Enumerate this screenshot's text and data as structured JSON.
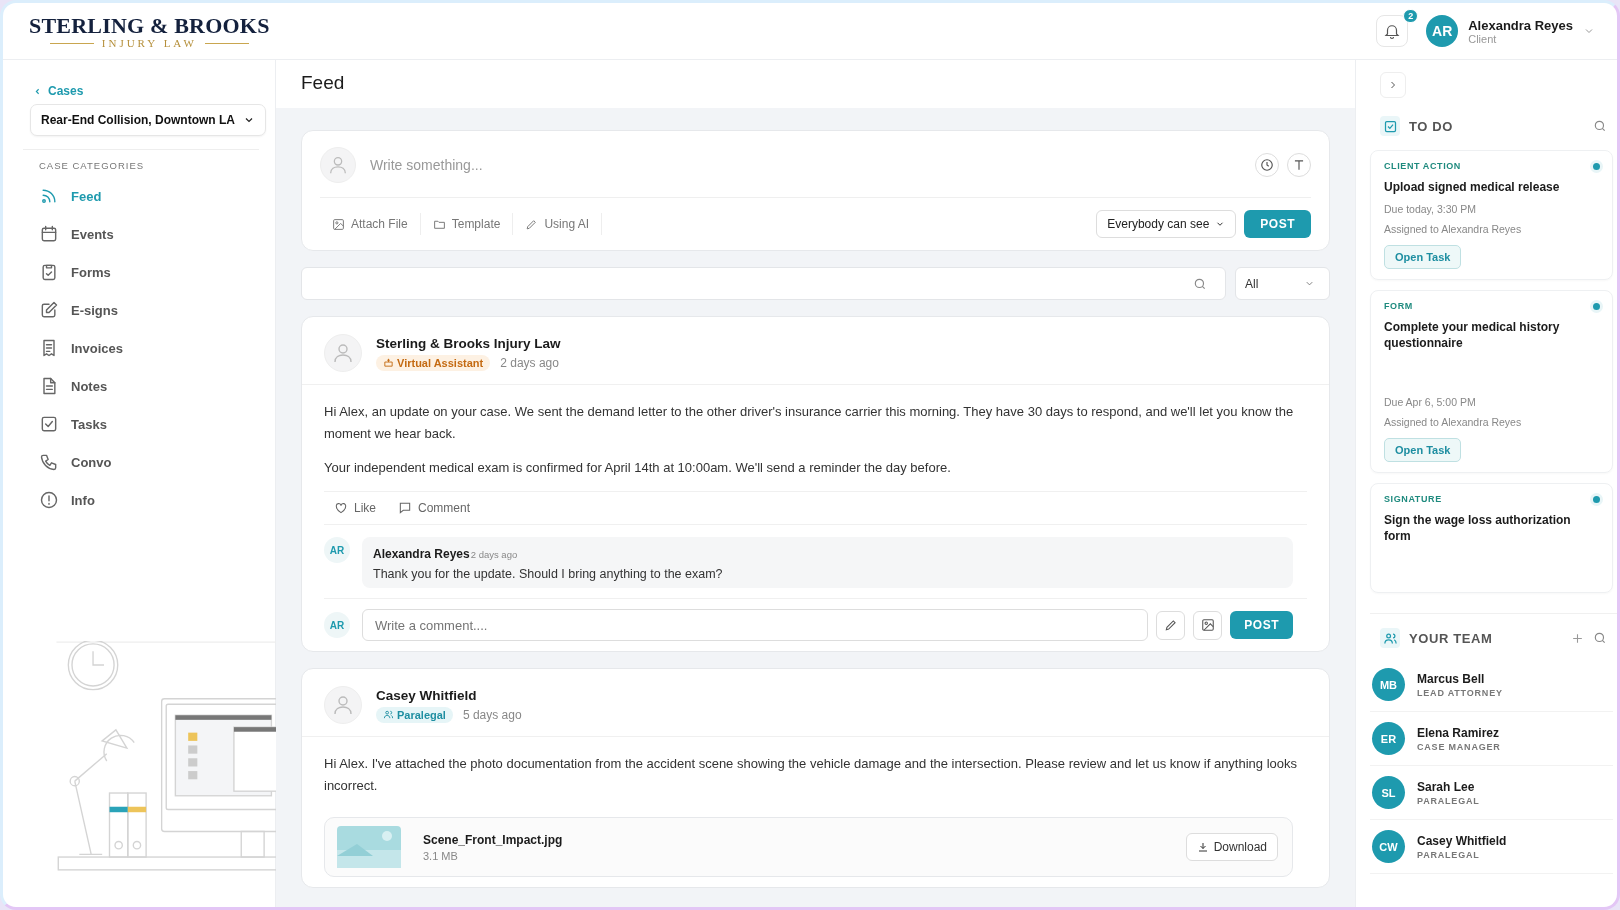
{
  "header": {
    "logo_main": "STERLING & BROOKS",
    "logo_sub": "INJURY LAW",
    "notifications": "2",
    "user": {
      "initials": "AR",
      "name": "Alexandra Reyes",
      "role": "Client"
    }
  },
  "sidebar": {
    "back": "Cases",
    "case": "Rear-End Collision, Downtown LA",
    "section": "CASE CATEGORIES",
    "items": [
      {
        "label": "Feed",
        "selected": true
      },
      {
        "label": "Events",
        "selected": false
      },
      {
        "label": "Forms",
        "selected": false
      },
      {
        "label": "E-signs",
        "selected": false
      },
      {
        "label": "Invoices",
        "selected": false
      },
      {
        "label": "Notes",
        "selected": false
      },
      {
        "label": "Tasks",
        "selected": false
      },
      {
        "label": "Convo",
        "selected": false
      },
      {
        "label": "Info",
        "selected": false
      }
    ]
  },
  "feed": {
    "title": "Feed",
    "composer": {
      "placeholder": "Write something...",
      "actions": [
        "Attach File",
        "Template",
        "Using AI"
      ],
      "visibility": "Everybody can see",
      "post": "POST"
    },
    "filter": {
      "value": "All"
    },
    "posts": [
      {
        "author": "Sterling & Brooks Injury Law",
        "badge": {
          "kind": "assistant",
          "label": "Virtual Assistant"
        },
        "time": "2 days ago",
        "paragraphs": [
          "Hi Alex, an update on your case. We sent the demand letter to the other driver's insurance carrier this morning. They have 30 days to respond, and we'll let you know the moment we hear back.",
          "Your independent medical exam is confirmed for April 14th at 10:00am. We'll send a reminder the day before."
        ],
        "like": "Like",
        "comment": "Comment",
        "comments": [
          {
            "initials": "AR",
            "author": "Alexandra Reyes",
            "time": "2 days ago",
            "text": "Thank you for the update. Should I bring anything to the exam?"
          }
        ],
        "reply": {
          "initials": "AR",
          "placeholder": "Write a comment....",
          "post": "POST"
        }
      },
      {
        "author": "Casey Whitfield",
        "badge": {
          "kind": "paralegal",
          "label": "Paralegal"
        },
        "time": "5 days ago",
        "paragraphs": [
          "Hi Alex. I've attached the photo documentation from the accident scene showing the vehicle damage and the intersection. Please review and let us know if anything looks incorrect."
        ],
        "attachment": {
          "name": "Scene_Front_Impact.jpg",
          "size": "3.1 MB",
          "action": "Download"
        }
      }
    ]
  },
  "todo": {
    "title": "TO DO",
    "tasks": [
      {
        "category": "CLIENT ACTION",
        "title": "Upload signed medical release",
        "due": "Due today, 3:30 PM",
        "assigned": "Assigned to Alexandra Reyes",
        "action": "Open Task",
        "unread": true
      },
      {
        "category": "FORM",
        "title": "Complete your medical history questionnaire",
        "due": "Due Apr 6, 5:00 PM",
        "assigned": "Assigned to Alexandra Reyes",
        "action": "Open Task",
        "unread": true
      },
      {
        "category": "SIGNATURE",
        "title": "Sign the wage loss authorization form",
        "unread": true
      }
    ]
  },
  "team": {
    "title": "YOUR TEAM",
    "members": [
      {
        "initials": "MB",
        "name": "Marcus Bell",
        "role": "LEAD ATTORNEY"
      },
      {
        "initials": "ER",
        "name": "Elena Ramirez",
        "role": "CASE MANAGER"
      },
      {
        "initials": "SL",
        "name": "Sarah Lee",
        "role": "PARALEGAL"
      },
      {
        "initials": "CW",
        "name": "Casey Whitfield",
        "role": "PARALEGAL"
      }
    ]
  }
}
